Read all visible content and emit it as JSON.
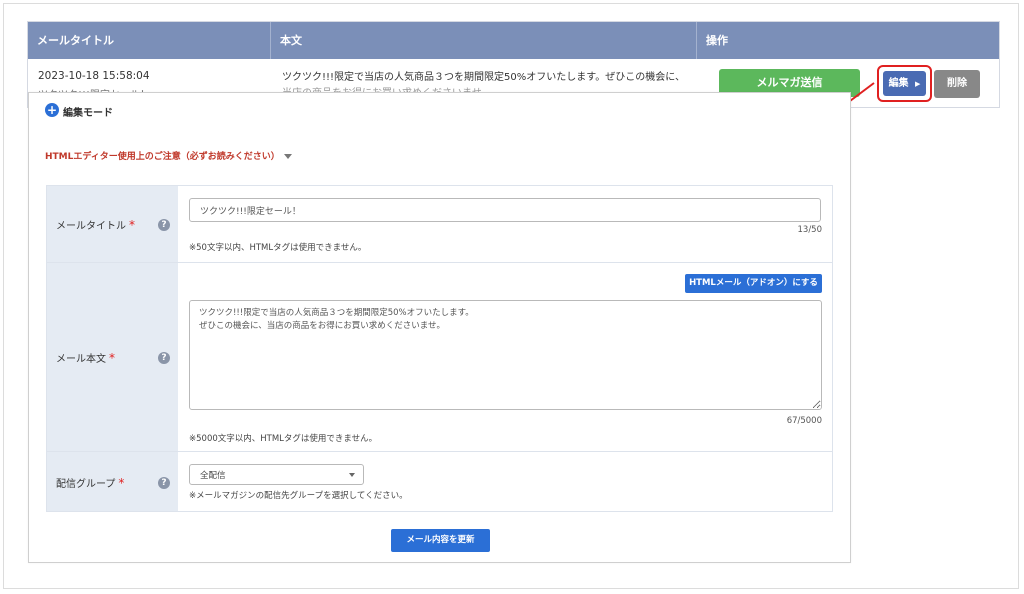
{
  "list": {
    "headers": {
      "title": "メールタイトル",
      "body": "本文",
      "ops": "操作"
    },
    "row": {
      "date": "2023-10-18 15:58:04",
      "title_cut": "ツクツク!!!限定セール！",
      "body_line1": "ツクツク!!!限定で当店の人気商品３つを期間限定50%オフいたします。ぜひこの機会に、",
      "body_line2_cut": "当店の商品をお得にお買い求めくださいませ。",
      "send_label": "メルマガ送信",
      "edit_label": "編集",
      "edit_caret": "▶",
      "delete_label": "削除"
    }
  },
  "panel": {
    "mode_label": "編集モード",
    "plus_glyph": "+",
    "notice": "HTMLエディター使用上のご注意（必ずお読みください）",
    "required_mark": "*",
    "help_glyph": "?",
    "title_field": {
      "label": "メールタイトル",
      "value": "ツクツク!!!限定セール！",
      "counter": "13/50",
      "note": "※50文字以内、HTMLタグは使用できません。"
    },
    "body_field": {
      "label": "メール本文",
      "html_button": "HTMLメール（アドオン）にする",
      "value": "ツクツク!!!限定で当店の人気商品３つを期間限定50%オフいたします。\nぜひこの機会に、当店の商品をお得にお買い求めくださいませ。",
      "counter": "67/5000",
      "note": "※5000文字以内、HTMLタグは使用できません。"
    },
    "group_field": {
      "label": "配信グループ",
      "selected": "全配信",
      "note": "※メールマガジンの配信先グループを選択してください。"
    },
    "update_button": "メール内容を更新"
  },
  "colors": {
    "table_header": "#7b8fb8",
    "send_green": "#5cb85c",
    "edit_blue": "#4a6bb3",
    "delete_gray": "#888888",
    "primary_blue": "#2b6fd6",
    "highlight_red": "#e02020",
    "label_bg": "#e5ebf3",
    "notice_red": "#c0392b"
  }
}
